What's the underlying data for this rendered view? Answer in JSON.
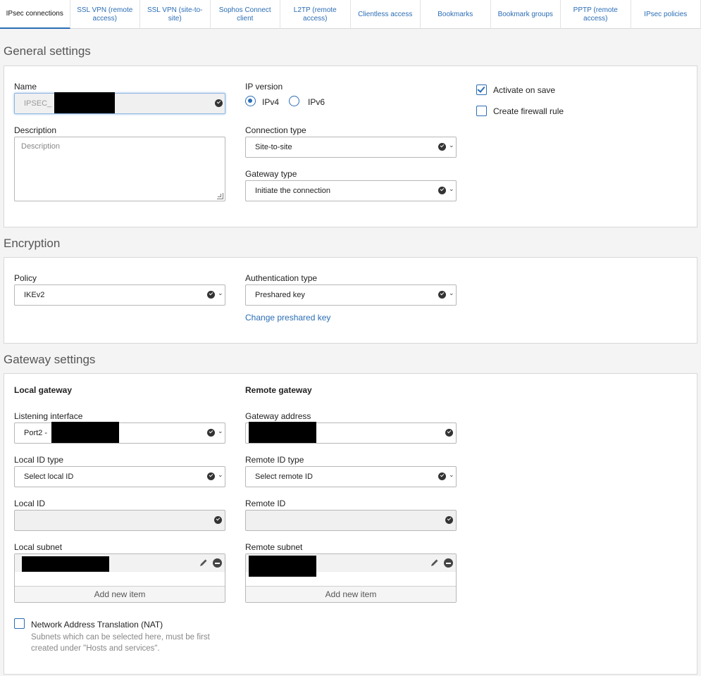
{
  "tabs": [
    {
      "label": "IPsec connections",
      "active": true
    },
    {
      "label": "SSL VPN (remote access)",
      "active": false
    },
    {
      "label": "SSL VPN (site-to-site)",
      "active": false
    },
    {
      "label": "Sophos Connect client",
      "active": false
    },
    {
      "label": "L2TP (remote access)",
      "active": false
    },
    {
      "label": "Clientless access",
      "active": false
    },
    {
      "label": "Bookmarks",
      "active": false
    },
    {
      "label": "Bookmark groups",
      "active": false
    },
    {
      "label": "PPTP (remote access)",
      "active": false
    },
    {
      "label": "IPsec policies",
      "active": false
    }
  ],
  "general": {
    "title": "General settings",
    "name_label": "Name",
    "name_value": "IPSEC_",
    "description_label": "Description",
    "description_placeholder": "Description",
    "ip_version_label": "IP version",
    "ipv4_label": "IPv4",
    "ipv6_label": "IPv6",
    "ip_version_selected": "IPv4",
    "connection_type_label": "Connection type",
    "connection_type_value": "Site-to-site",
    "gateway_type_label": "Gateway type",
    "gateway_type_value": "Initiate the connection",
    "activate_on_save_label": "Activate on save",
    "activate_on_save_checked": true,
    "create_firewall_rule_label": "Create firewall rule",
    "create_firewall_rule_checked": false
  },
  "encryption": {
    "title": "Encryption",
    "policy_label": "Policy",
    "policy_value": "IKEv2",
    "auth_type_label": "Authentication type",
    "auth_type_value": "Preshared key",
    "change_key_link": "Change preshared key"
  },
  "gateway": {
    "title": "Gateway settings",
    "local_heading": "Local gateway",
    "remote_heading": "Remote gateway",
    "listening_interface_label": "Listening interface",
    "listening_interface_value": "Port2 -",
    "gateway_address_label": "Gateway address",
    "local_id_type_label": "Local ID type",
    "local_id_type_value": "Select local ID",
    "remote_id_type_label": "Remote ID type",
    "remote_id_type_value": "Select remote ID",
    "local_id_label": "Local ID",
    "remote_id_label": "Remote ID",
    "local_subnet_label": "Local subnet",
    "remote_subnet_label": "Remote subnet",
    "add_new_item": "Add new item",
    "nat_label": "Network Address Translation (NAT)",
    "nat_checked": false,
    "nat_hint": "Subnets which can be selected here, must be first created under \"Hosts and services\"."
  },
  "colors": {
    "accent": "#2b6db5",
    "panel_bg": "#ffffff",
    "page_bg": "#f4f4f4"
  }
}
